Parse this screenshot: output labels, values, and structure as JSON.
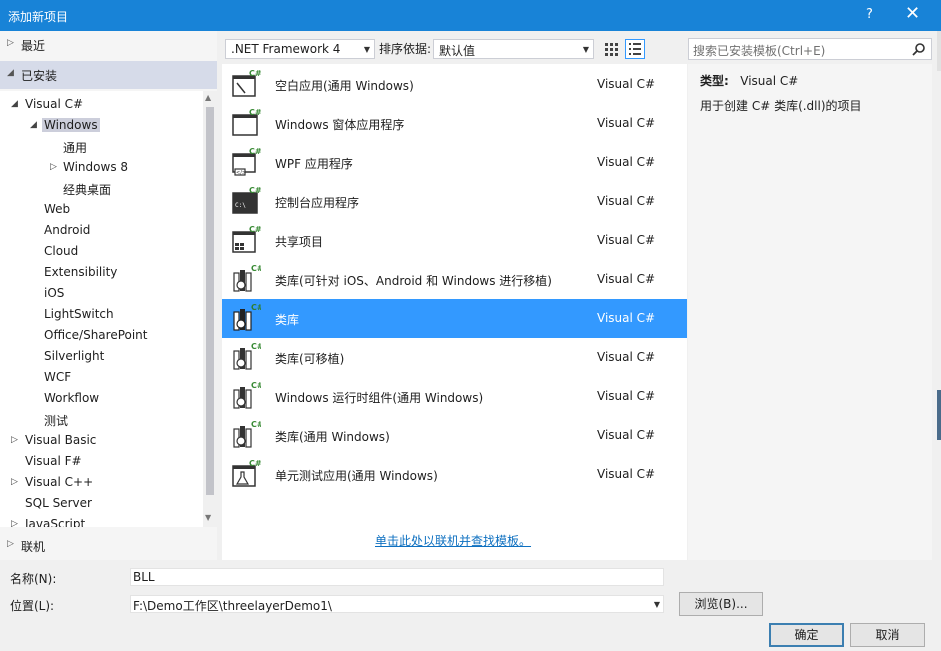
{
  "window": {
    "title": "添加新项目",
    "help": "?",
    "close": "✕"
  },
  "left": {
    "recent": "最近",
    "installed": "已安装",
    "online": "联机",
    "tree": [
      {
        "label": "Visual C#"
      },
      {
        "label": "Windows"
      },
      {
        "label": "通用"
      },
      {
        "label": "Windows 8"
      },
      {
        "label": "经典桌面"
      },
      {
        "label": "Web"
      },
      {
        "label": "Android"
      },
      {
        "label": "Cloud"
      },
      {
        "label": "Extensibility"
      },
      {
        "label": "iOS"
      },
      {
        "label": "LightSwitch"
      },
      {
        "label": "Office/SharePoint"
      },
      {
        "label": "Silverlight"
      },
      {
        "label": "WCF"
      },
      {
        "label": "Workflow"
      },
      {
        "label": "测试"
      },
      {
        "label": "Visual Basic"
      },
      {
        "label": "Visual F#"
      },
      {
        "label": "Visual C++"
      },
      {
        "label": "SQL Server"
      },
      {
        "label": "JavaScript"
      }
    ]
  },
  "toolbar": {
    "framework": ".NET Framework 4",
    "sort_label": "排序依据:",
    "sort_value": "默认值"
  },
  "search": {
    "placeholder": "搜索已安装模板(Ctrl+E)"
  },
  "templates": [
    {
      "name": "空白应用(通用 Windows)",
      "lang": "Visual C#",
      "icon": "blank-app-icon"
    },
    {
      "name": "Windows 窗体应用程序",
      "lang": "Visual C#",
      "icon": "windows-forms-icon"
    },
    {
      "name": "WPF 应用程序",
      "lang": "Visual C#",
      "icon": "wpf-app-icon"
    },
    {
      "name": "控制台应用程序",
      "lang": "Visual C#",
      "icon": "console-app-icon"
    },
    {
      "name": "共享项目",
      "lang": "Visual C#",
      "icon": "shared-project-icon"
    },
    {
      "name": "类库(可针对 iOS、Android 和 Windows 进行移植)",
      "lang": "Visual C#",
      "icon": "class-library-icon"
    },
    {
      "name": "类库",
      "lang": "Visual C#",
      "icon": "class-library-icon"
    },
    {
      "name": "类库(可移植)",
      "lang": "Visual C#",
      "icon": "class-library-icon"
    },
    {
      "name": "Windows 运行时组件(通用 Windows)",
      "lang": "Visual C#",
      "icon": "runtime-component-icon"
    },
    {
      "name": "类库(通用 Windows)",
      "lang": "Visual C#",
      "icon": "class-library-icon"
    },
    {
      "name": "单元测试应用(通用 Windows)",
      "lang": "Visual C#",
      "icon": "unit-test-icon"
    }
  ],
  "online_link": "单击此处以联机并查找模板。",
  "details": {
    "type_label": "类型:",
    "type_value": "Visual C#",
    "description": "用于创建 C# 类库(.dll)的项目"
  },
  "form": {
    "name_label": "名称(N):",
    "name_value": "BLL",
    "location_label": "位置(L):",
    "location_value": "F:\\Demo工作区\\threelayerDemo1\\",
    "browse": "浏览(B)...",
    "ok": "确定",
    "cancel": "取消"
  },
  "colors": {
    "accent": "#1883d7",
    "selection": "#3399ff",
    "link": "#0e70c0"
  }
}
